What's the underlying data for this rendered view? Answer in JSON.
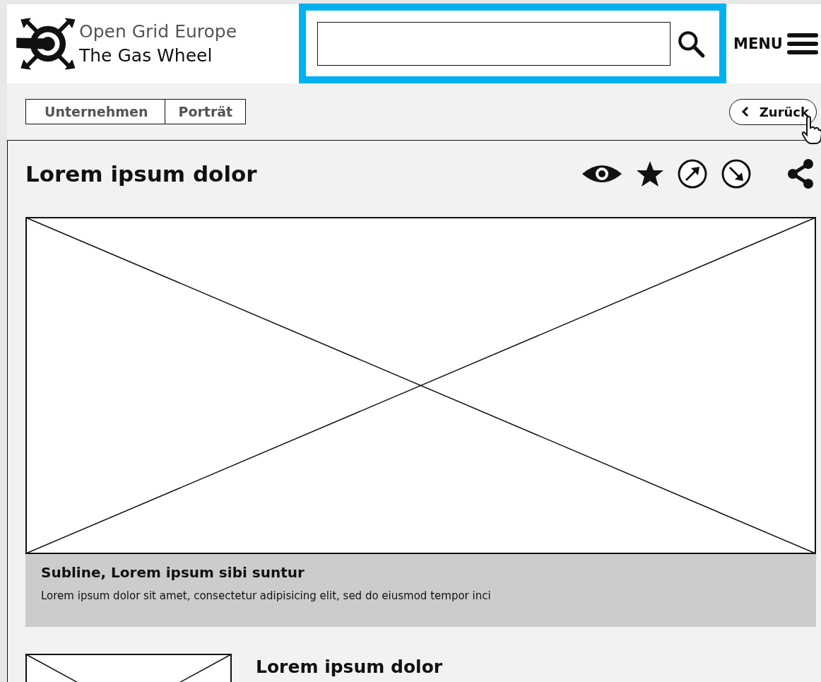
{
  "logo": {
    "line_1": "Open Grid Europe",
    "line_2": "The Gas Wheel"
  },
  "menu": {
    "label": "MENU"
  },
  "breadcrumb": [
    "Unternehmen",
    "Porträt"
  ],
  "back_button": {
    "label": "Zurück"
  },
  "article": {
    "title": "Lorem ipsum dolor",
    "caption": {
      "subline": "Subline, Lorem ipsum sibi suntur",
      "text": "Lorem ipsum dolor sit amet, consectetur adipisicing elit, sed do eiusmod tempor inci"
    }
  },
  "teaser": {
    "title": "Lorem ipsum dolor"
  }
}
